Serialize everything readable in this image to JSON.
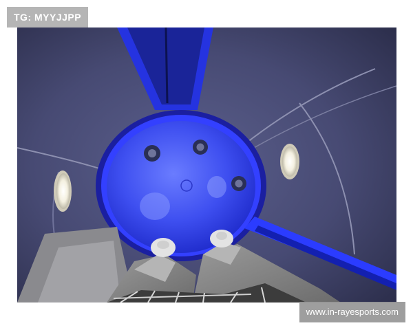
{
  "watermarks": {
    "top_left": "TG: MYYJJPP",
    "bottom_right": "www.in-rayesports.com"
  },
  "scene": {
    "subject": "pov-inside-blue-lit-slide-tube",
    "accent_color": "#2b3cff",
    "wall_color": "#3d4066"
  }
}
